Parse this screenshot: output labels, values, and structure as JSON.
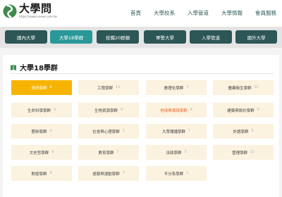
{
  "brand": {
    "name": "大學問",
    "url": "https://www.unews.com.tw"
  },
  "nav": [
    "首頁",
    "大學校系",
    "入學管道",
    "大學情報",
    "會員服務"
  ],
  "categories": [
    "國內大學",
    "大學18學群",
    "技職20群類",
    "軍警大學",
    "入學管道",
    "國外大學"
  ],
  "active_category": "大學18學群",
  "section_title": "大學18學群",
  "groups": [
    {
      "label": "資訊學群",
      "count": "8"
    },
    {
      "label": "工程學群",
      "count": "13"
    },
    {
      "label": "數理化學群",
      "count": "7"
    },
    {
      "label": "醫藥衛生學群",
      "count": "11"
    },
    {
      "label": "生命科學學群",
      "count": "9"
    },
    {
      "label": "生物資源學群",
      "count": "9"
    },
    {
      "label": "地球與環境學群",
      "count": "8"
    },
    {
      "label": "建築與設計學群",
      "count": "9"
    },
    {
      "label": "藝術學群",
      "count": "4"
    },
    {
      "label": "社會與心理學群",
      "count": "5"
    },
    {
      "label": "大眾傳播學群",
      "count": "7"
    },
    {
      "label": "外語學群",
      "count": "5"
    },
    {
      "label": "文史哲學群",
      "count": "6"
    },
    {
      "label": "教育學群",
      "count": "7"
    },
    {
      "label": "法政學群",
      "count": "5"
    },
    {
      "label": "管理學群",
      "count": "12"
    },
    {
      "label": "財經學群",
      "count": "9"
    },
    {
      "label": "遊憩與運動學群",
      "count": "7"
    },
    {
      "label": "不分系學群",
      "count": "1"
    }
  ],
  "colors": {
    "nav_dark": "#2d5656",
    "nav_active": "#2a9898",
    "tile_bg": "#fbf2df",
    "tile_active": "#f6b400",
    "highlight_text": "#e16a2b",
    "logo_green": "#3d8a4c"
  }
}
